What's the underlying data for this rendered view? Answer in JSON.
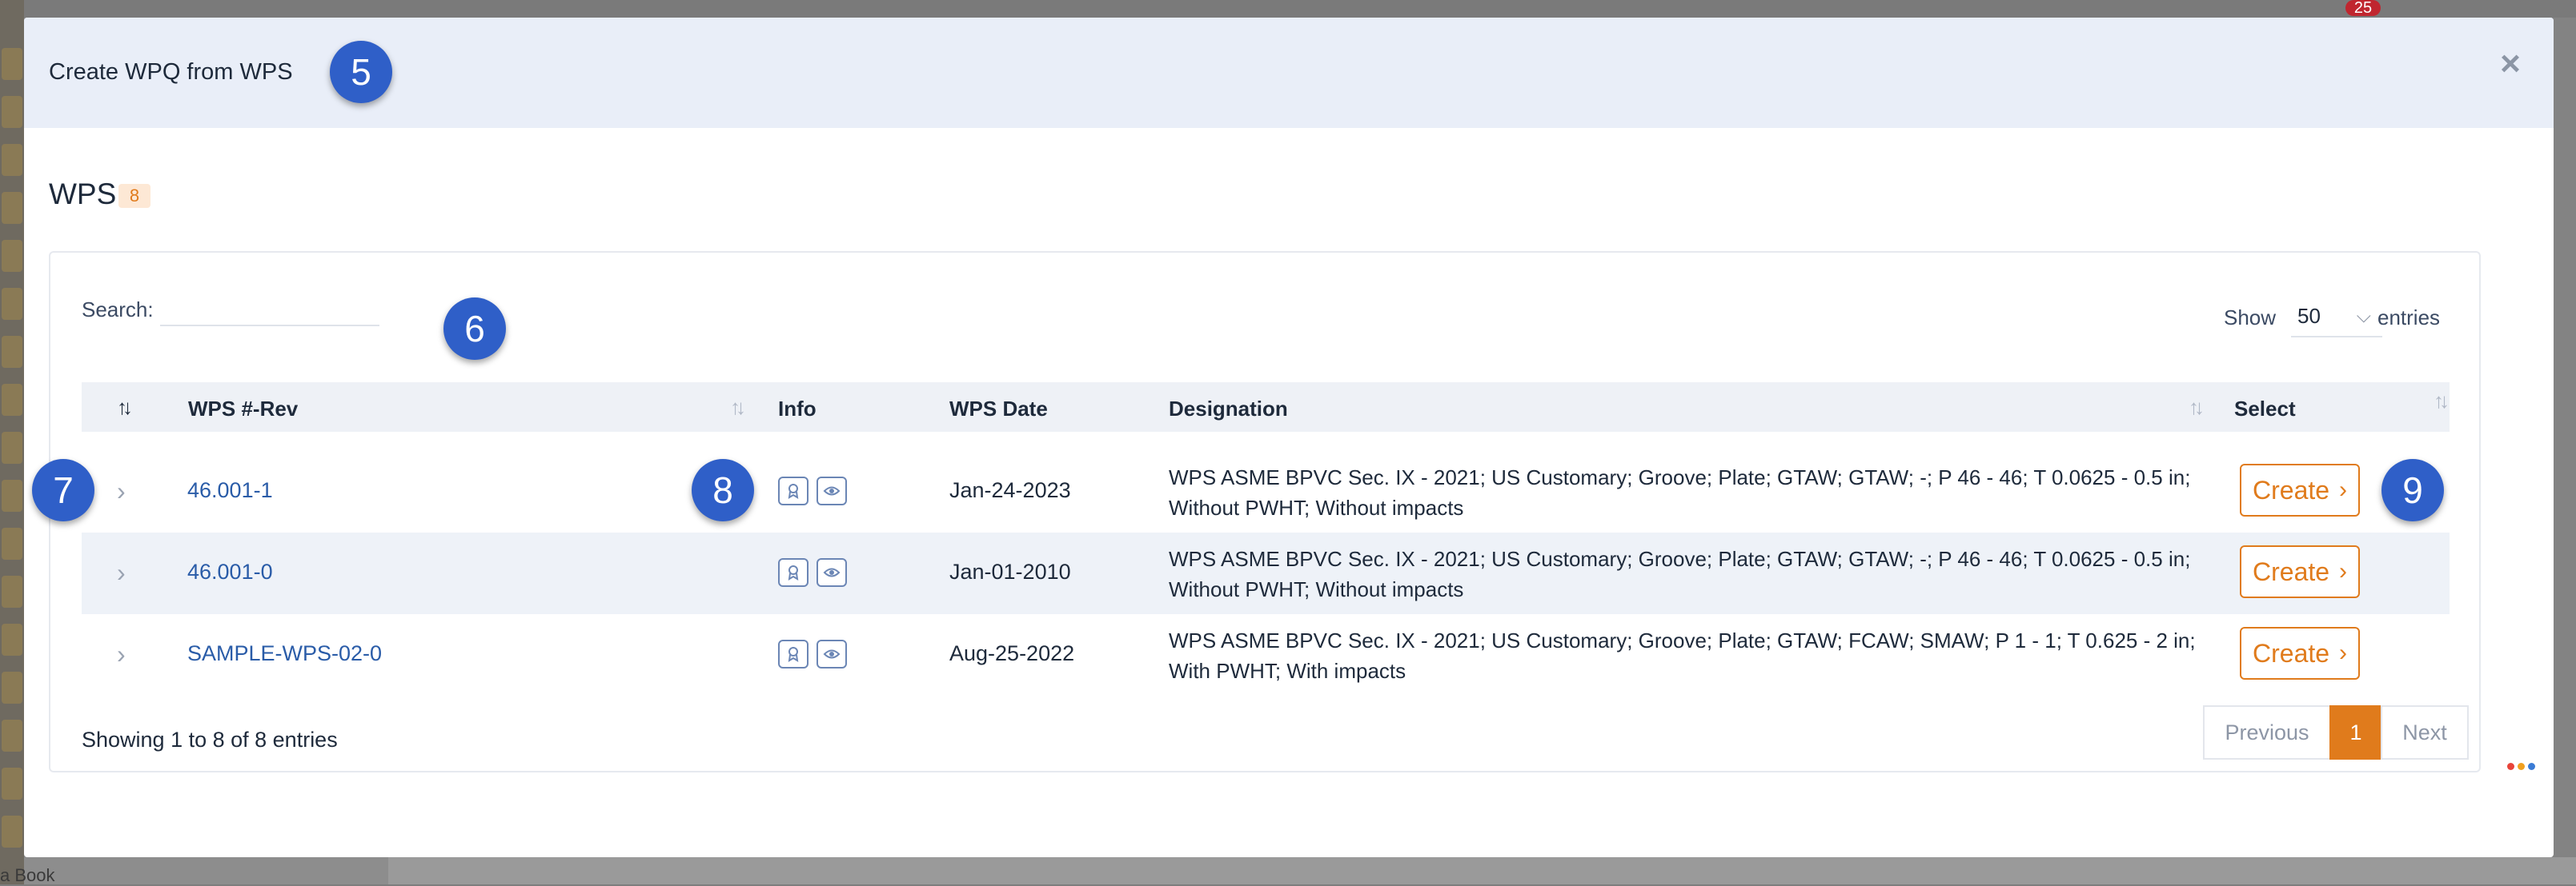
{
  "background": {
    "notification_count": "25",
    "bottom_label": "a Book"
  },
  "modal": {
    "title": "Create WPQ from WPS",
    "close_label": "×"
  },
  "section": {
    "title": "WPS",
    "count": "8"
  },
  "search": {
    "label": "Search:",
    "value": ""
  },
  "length": {
    "show_label": "Show",
    "selected": "50",
    "entries_label": "entries"
  },
  "table": {
    "columns": {
      "wps_rev": "WPS #-Rev",
      "info": "Info",
      "wps_date": "WPS Date",
      "designation": "Designation",
      "select": "Select"
    },
    "rows": [
      {
        "wps_rev": "46.001-1",
        "wps_date": "Jan-24-2023",
        "designation": "WPS ASME BPVC Sec. IX - 2021; US Customary; Groove; Plate; GTAW; GTAW; -; P 46 - 46; T 0.0625 - 0.5 in; Without PWHT; Without impacts",
        "create_label": "Create"
      },
      {
        "wps_rev": "46.001-0",
        "wps_date": "Jan-01-2010",
        "designation": "WPS ASME BPVC Sec. IX - 2021; US Customary; Groove; Plate; GTAW; GTAW; -; P 46 - 46; T 0.0625 - 0.5 in; Without PWHT; Without impacts",
        "create_label": "Create"
      },
      {
        "wps_rev": "SAMPLE-WPS-02-0",
        "wps_date": "Aug-25-2022",
        "designation": "WPS ASME BPVC Sec. IX - 2021; US Customary; Groove; Plate; GTAW; FCAW; SMAW; P 1 - 1; T 0.625 - 2 in; With PWHT; With impacts",
        "create_label": "Create"
      }
    ]
  },
  "footer": {
    "showing": "Showing 1 to 8 of 8 entries"
  },
  "pagination": {
    "previous": "Previous",
    "current": "1",
    "next": "Next"
  },
  "annotations": {
    "five": "5",
    "six": "6",
    "seven": "7",
    "eight": "8",
    "nine": "9"
  },
  "colors": {
    "accent": "#e07b1c",
    "link": "#2a5ca8",
    "annotation": "#2f5fc8",
    "header_bg": "#e9eef8"
  }
}
